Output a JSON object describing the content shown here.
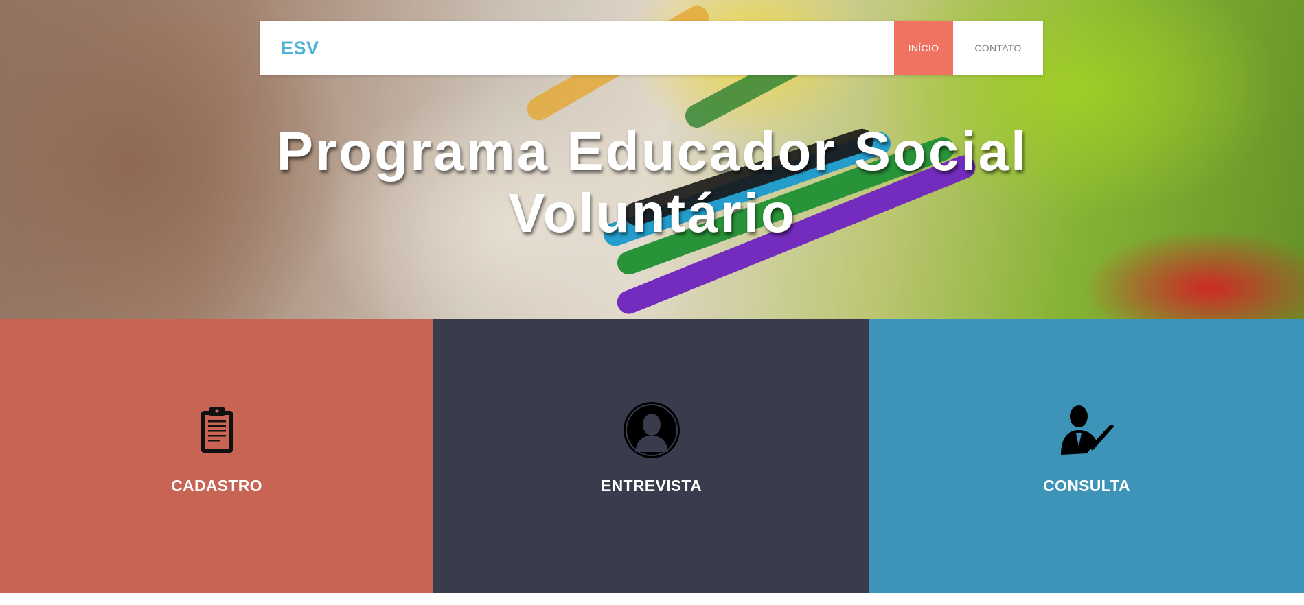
{
  "navbar": {
    "brand": "ESV",
    "items": [
      {
        "label": "INÍCIO",
        "active": true
      },
      {
        "label": "CONTATO",
        "active": false
      }
    ]
  },
  "hero": {
    "title_line1": "Programa Educador Social",
    "title_line2": "Voluntário"
  },
  "tiles": [
    {
      "label": "CADASTRO",
      "icon": "clipboard-icon",
      "color": "#c86454"
    },
    {
      "label": "ENTREVISTA",
      "icon": "user-silhouette-icon",
      "color": "#383c4c"
    },
    {
      "label": "CONSULTA",
      "icon": "user-check-icon",
      "color": "#3e93b8"
    }
  ],
  "colors": {
    "brand": "#4fb3d6",
    "nav_active": "#ef7360"
  }
}
